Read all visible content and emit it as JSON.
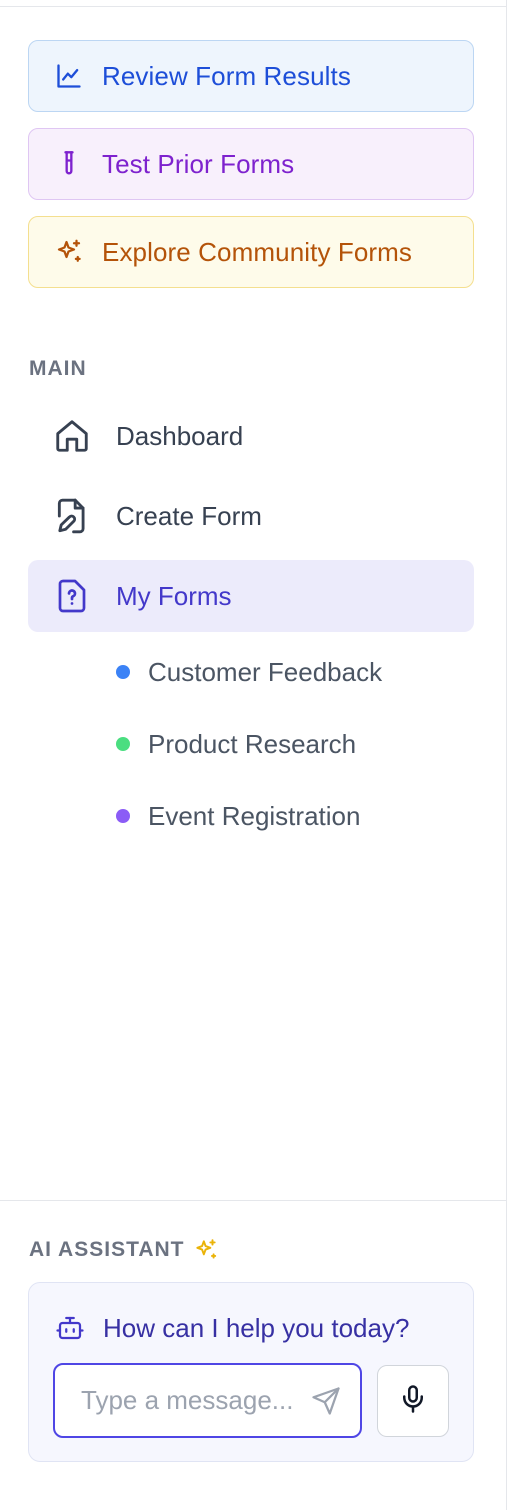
{
  "quick_actions": [
    {
      "label": "Review Form Results",
      "icon": "chart-line-icon",
      "color": "#1d4ed8"
    },
    {
      "label": "Test Prior Forms",
      "icon": "test-tube-icon",
      "color": "#7e22ce"
    },
    {
      "label": "Explore Community Forms",
      "icon": "sparkles-icon",
      "color": "#b45309"
    }
  ],
  "main_section": {
    "label": "MAIN",
    "items": [
      {
        "label": "Dashboard",
        "icon": "home-icon",
        "active": false
      },
      {
        "label": "Create Form",
        "icon": "file-edit-icon",
        "active": false
      },
      {
        "label": "My Forms",
        "icon": "file-question-icon",
        "active": true
      }
    ],
    "sub_items": [
      {
        "label": "Customer Feedback",
        "dot_color": "#3b82f6"
      },
      {
        "label": "Product Research",
        "dot_color": "#4ade80"
      },
      {
        "label": "Event Registration",
        "dot_color": "#8b5cf6"
      }
    ]
  },
  "assistant": {
    "label": "AI ASSISTANT",
    "label_icon": "sparkles-icon",
    "prompt": "How can I help you today?",
    "prompt_icon": "bot-icon",
    "input_placeholder": "Type a message...",
    "input_value": "",
    "send_icon": "send-icon",
    "mic_icon": "microphone-icon"
  }
}
